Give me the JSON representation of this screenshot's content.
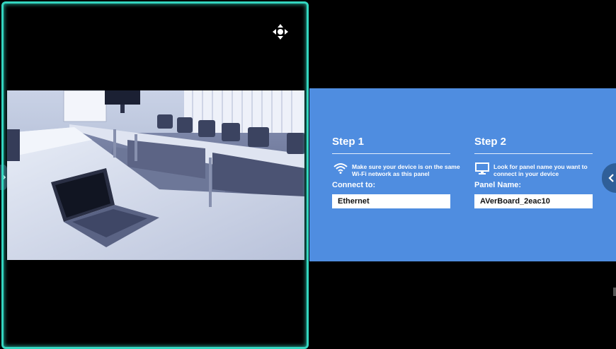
{
  "colors": {
    "accent_frame": "#33d6c0",
    "card_bg": "#4f8de0",
    "collapse_tab": "#2f5f99"
  },
  "icons": {
    "move": "move-arrows-icon",
    "wifi": "wifi-icon",
    "monitor": "monitor-icon",
    "collapse": "chevron-left-icon",
    "expand": "chevron-right-icon"
  },
  "step1": {
    "title": "Step 1",
    "desc_line1": "Make sure your device is on the same",
    "desc_line2": "Wi-Fi network as this panel",
    "field_label": "Connect to:",
    "field_value": "Ethernet"
  },
  "step2": {
    "title": "Step 2",
    "desc_line1": "Look for panel name you want to",
    "desc_line2": "connect in your device",
    "field_label": "Panel Name:",
    "field_value": "AVerBoard_2eac10"
  }
}
